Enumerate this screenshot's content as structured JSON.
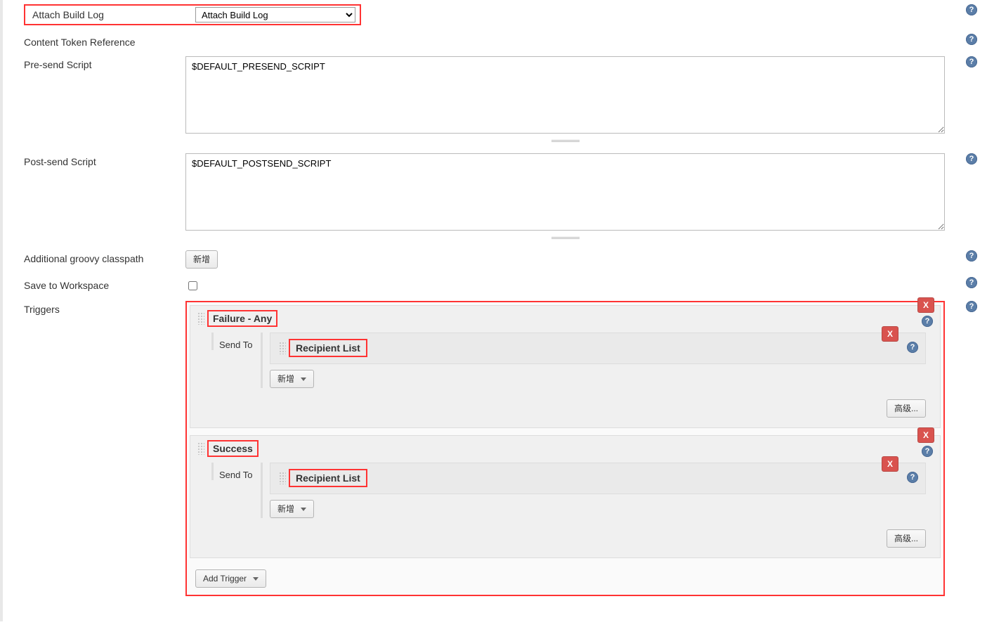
{
  "attachBuildLog": {
    "label": "Attach Build Log",
    "selected": "Attach Build Log"
  },
  "contentTokenRef": {
    "label": "Content Token Reference"
  },
  "preSend": {
    "label": "Pre-send Script",
    "value": "$DEFAULT_PRESEND_SCRIPT"
  },
  "postSend": {
    "label": "Post-send Script",
    "value": "$DEFAULT_POSTSEND_SCRIPT"
  },
  "classpath": {
    "label": "Additional groovy classpath",
    "addBtn": "新增"
  },
  "saveWorkspace": {
    "label": "Save to Workspace"
  },
  "triggers": {
    "label": "Triggers",
    "addTrigger": "Add Trigger",
    "items": [
      {
        "title": "Failure - Any",
        "sendTo": "Send To",
        "recipient": "Recipient List",
        "addBtn": "新增",
        "advBtn": "高级..."
      },
      {
        "title": "Success",
        "sendTo": "Send To",
        "recipient": "Recipient List",
        "addBtn": "新增",
        "advBtn": "高级..."
      }
    ]
  },
  "del": "X"
}
